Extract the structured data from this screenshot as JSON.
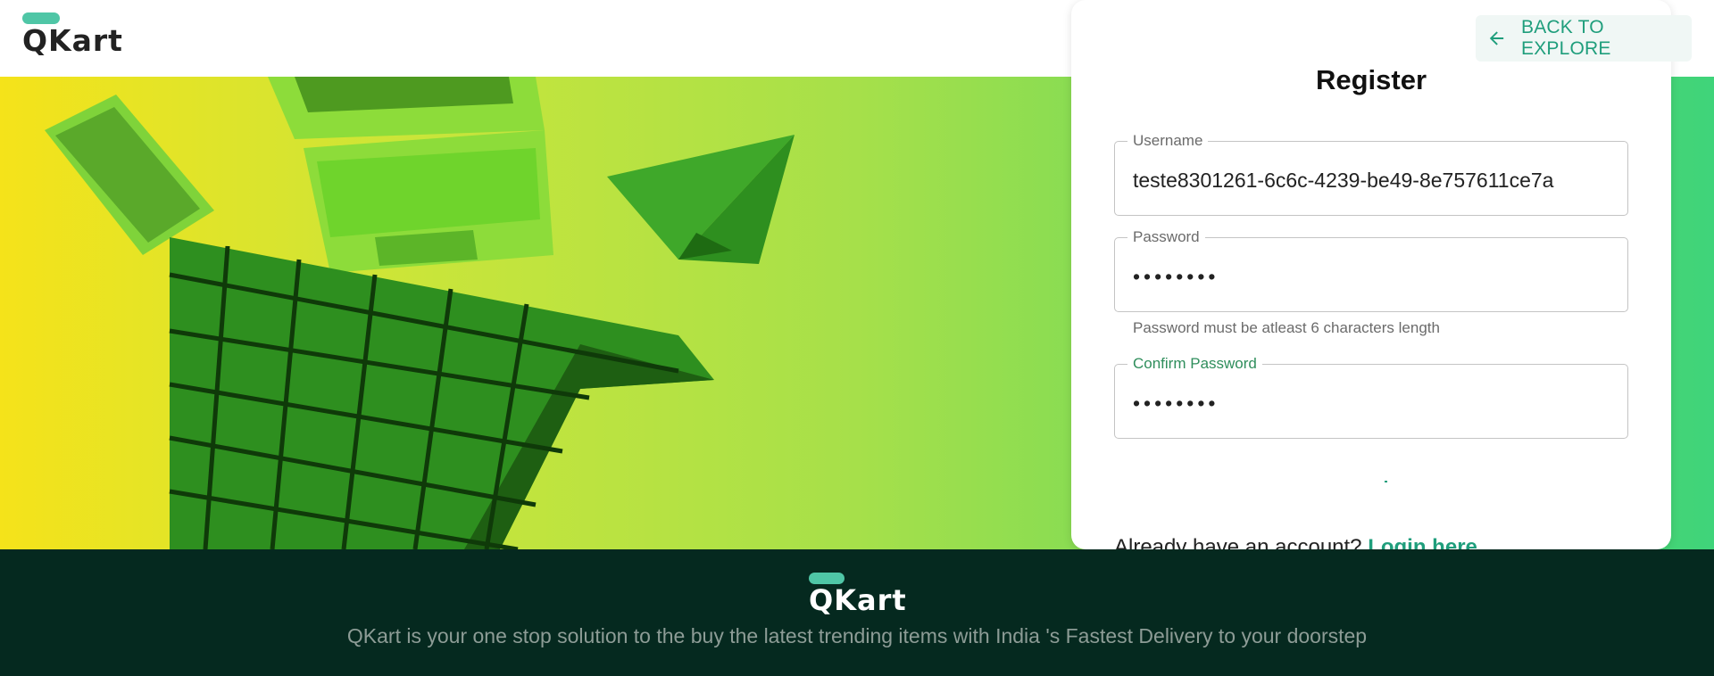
{
  "header": {
    "logo": "QKart",
    "back_button": "BACK TO EXPLORE"
  },
  "form": {
    "title": "Register",
    "username_label": "Username",
    "username_value": "teste8301261-6c6c-4239-be49-8e757611ce7a",
    "password_label": "Password",
    "password_value": "••••••••",
    "password_helper": "Password must be atleast 6 characters length",
    "confirm_label": "Confirm Password",
    "confirm_value": "••••••••",
    "already_text": "Already have an account?",
    "login_link": "Login here"
  },
  "footer": {
    "logo": "QKart",
    "description": "QKart is your one stop solution to the buy the latest trending items with India 's Fastest Delivery to your doorstep"
  },
  "colors": {
    "accent": "#1f9e7c",
    "logo_bar": "#4fc6a6",
    "footer_bg": "#05291f"
  },
  "icons": {
    "back": "arrow-left-icon"
  }
}
